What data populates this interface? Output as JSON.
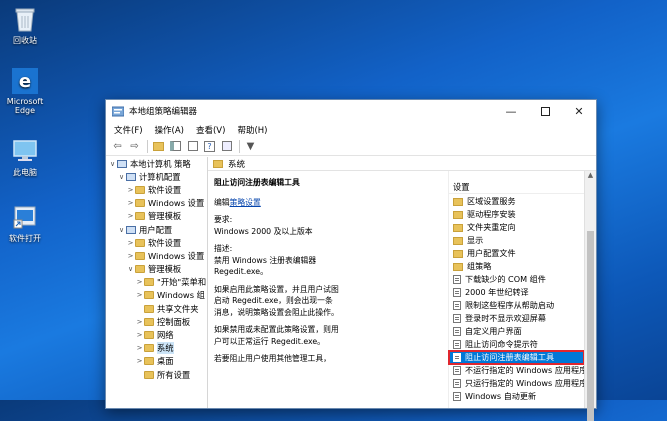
{
  "desktop": {
    "icons": [
      {
        "label": "回收站"
      },
      {
        "label": "Microsoft Edge"
      },
      {
        "label": "此电脑"
      },
      {
        "label": "软件打开"
      }
    ]
  },
  "window": {
    "title": "本地组策略编辑器",
    "menu": [
      "文件(F)",
      "操作(A)",
      "查看(V)",
      "帮助(H)"
    ],
    "tree": [
      {
        "label": "本地计算机 策略",
        "indent": 0,
        "arrow": "∨",
        "icon": "pc"
      },
      {
        "label": "计算机配置",
        "indent": 1,
        "arrow": "∨",
        "icon": "pc"
      },
      {
        "label": "软件设置",
        "indent": 2,
        "arrow": ">",
        "icon": "folder"
      },
      {
        "label": "Windows 设置",
        "indent": 2,
        "arrow": ">",
        "icon": "folder"
      },
      {
        "label": "管理模板",
        "indent": 2,
        "arrow": ">",
        "icon": "folder"
      },
      {
        "label": "用户配置",
        "indent": 1,
        "arrow": "∨",
        "icon": "pc"
      },
      {
        "label": "软件设置",
        "indent": 2,
        "arrow": ">",
        "icon": "folder"
      },
      {
        "label": "Windows 设置",
        "indent": 2,
        "arrow": ">",
        "icon": "folder"
      },
      {
        "label": "管理模板",
        "indent": 2,
        "arrow": "∨",
        "icon": "folder"
      },
      {
        "label": "\"开始\"菜单和",
        "indent": 3,
        "arrow": ">",
        "icon": "folder"
      },
      {
        "label": "Windows 组",
        "indent": 3,
        "arrow": ">",
        "icon": "folder"
      },
      {
        "label": "共享文件夹",
        "indent": 3,
        "arrow": "",
        "icon": "folder"
      },
      {
        "label": "控制面板",
        "indent": 3,
        "arrow": ">",
        "icon": "folder"
      },
      {
        "label": "网络",
        "indent": 3,
        "arrow": ">",
        "icon": "folder"
      },
      {
        "label": "系统",
        "indent": 3,
        "arrow": ">",
        "icon": "folder",
        "selected": true
      },
      {
        "label": "桌面",
        "indent": 3,
        "arrow": ">",
        "icon": "folder"
      },
      {
        "label": "所有设置",
        "indent": 3,
        "arrow": "",
        "icon": "folder"
      }
    ],
    "right_header": "系统",
    "description": {
      "title": "阻止访问注册表编辑工具",
      "edit_prefix": "编辑",
      "edit_link": "策略设置",
      "req_label": "要求:",
      "req_value": "Windows 2000 及以上版本",
      "desc_label": "描述:",
      "desc_value": "禁用 Windows 注册表编辑器 Regedit.exe。",
      "para1": "如果启用此策略设置，并且用户试图启动 Regedit.exe，则会出现一条消息，说明策略设置会阻止此操作。",
      "para2": "如果禁用或未配置此策略设置，则用户可以正常运行 Regedit.exe。",
      "para3": "若要阻止用户使用其他管理工具，"
    },
    "settings_header": "设置",
    "settings": [
      {
        "label": "区域设置服务",
        "type": "folder"
      },
      {
        "label": "驱动程序安装",
        "type": "folder"
      },
      {
        "label": "文件夹重定向",
        "type": "folder"
      },
      {
        "label": "显示",
        "type": "folder"
      },
      {
        "label": "用户配置文件",
        "type": "folder"
      },
      {
        "label": "组策略",
        "type": "folder"
      },
      {
        "label": "下载缺少的 COM 组件",
        "type": "policy"
      },
      {
        "label": "2000 年世纪转译",
        "type": "policy"
      },
      {
        "label": "限制这些程序从帮助启动",
        "type": "policy"
      },
      {
        "label": "登录时不显示欢迎屏幕",
        "type": "policy"
      },
      {
        "label": "自定义用户界面",
        "type": "policy"
      },
      {
        "label": "阻止访问命令提示符",
        "type": "policy"
      },
      {
        "label": "阻止访问注册表编辑工具",
        "type": "policy",
        "highlighted": true
      },
      {
        "label": "不运行指定的 Windows 应用程序",
        "type": "policy"
      },
      {
        "label": "只运行指定的 Windows 应用程序",
        "type": "policy"
      },
      {
        "label": "Windows 自动更新",
        "type": "policy"
      }
    ]
  }
}
